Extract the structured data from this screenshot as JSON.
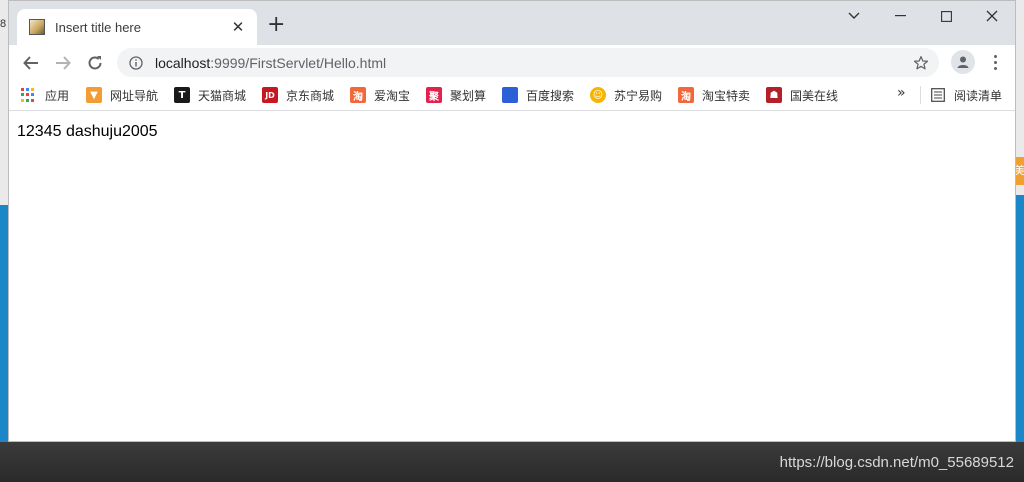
{
  "background": {
    "left_edge_text": "8",
    "right_edge_text": "美"
  },
  "tab": {
    "title": "Insert title here",
    "close_glyph": "✕"
  },
  "new_tab_glyph": "+",
  "address_bar": {
    "host": "localhost",
    "path": ":9999/FirstServlet/Hello.html"
  },
  "bookmarks": [
    {
      "label": "应用",
      "icon": "apps-grid-icon"
    },
    {
      "label": "网址导航",
      "icon": "nav-icon",
      "color": "#f39c34",
      "glyph": "▼"
    },
    {
      "label": "天猫商城",
      "icon": "tmall-icon",
      "color": "#1a1a1a",
      "glyph": "T"
    },
    {
      "label": "京东商城",
      "icon": "jd-icon",
      "color": "#c81623",
      "glyph": "JD"
    },
    {
      "label": "爱淘宝",
      "icon": "taobao-icon",
      "color": "#f2683a",
      "glyph": "淘"
    },
    {
      "label": "聚划算",
      "icon": "juhuasuan-icon",
      "color": "#e0224f",
      "glyph": "聚"
    },
    {
      "label": "百度搜索",
      "icon": "baidu-icon",
      "color": "#2f5fd8",
      "glyph": "🐾"
    },
    {
      "label": "苏宁易购",
      "icon": "suning-icon",
      "color": "#f7b500",
      "glyph": "☺"
    },
    {
      "label": "淘宝特卖",
      "icon": "taobao-sale-icon",
      "color": "#f2683a",
      "glyph": "淘"
    },
    {
      "label": "国美在线",
      "icon": "gome-icon",
      "color": "#b3202a",
      "glyph": "☗"
    }
  ],
  "bookmarks_more_glyph": "»",
  "reading_list": {
    "label": "阅读清单"
  },
  "page": {
    "content_text": "12345 dashuju2005"
  },
  "watermark": "https://blog.csdn.net/m0_55689512"
}
